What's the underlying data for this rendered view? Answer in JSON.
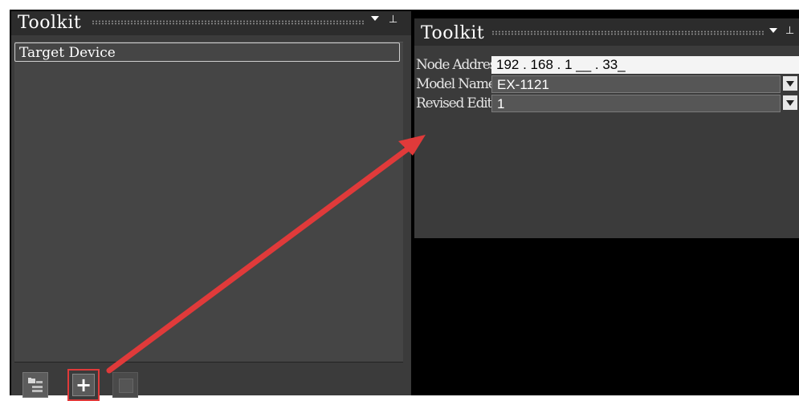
{
  "left_panel": {
    "title": "Toolkit",
    "list_items": [
      "Target Device"
    ],
    "toolbar": {
      "folder_icon": "folder-tree-icon",
      "add_label": "+",
      "third_icon": "square-icon"
    }
  },
  "right_panel": {
    "title": "Toolkit",
    "fields": [
      {
        "label": "Node Address",
        "value": "192 . 168 . 1 __ . 33_"
      },
      {
        "label": "Model Name",
        "value": "EX-1121"
      },
      {
        "label": "Revised Edition",
        "value": "1"
      }
    ]
  },
  "colors": {
    "panel_bg": "#3b3b3b",
    "title_bg": "#2c2c2c",
    "highlight": "#e03a3a",
    "background": "#000000"
  }
}
